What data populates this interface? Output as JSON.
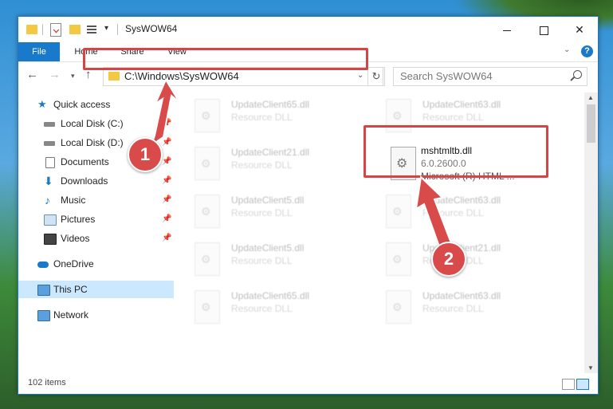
{
  "window": {
    "title": "SysWOW64"
  },
  "ribbon": {
    "tabs": [
      {
        "label": "File"
      },
      {
        "label": "Home"
      },
      {
        "label": "Share"
      },
      {
        "label": "View"
      }
    ],
    "help": "?"
  },
  "nav": {
    "address": "C:\\Windows\\SysWOW64",
    "search_placeholder": "Search SysWOW64"
  },
  "sidebar": {
    "items": [
      {
        "label": "Quick access"
      },
      {
        "label": "Local Disk (C:)"
      },
      {
        "label": "Local Disk (D:)"
      },
      {
        "label": "Documents"
      },
      {
        "label": "Downloads"
      },
      {
        "label": "Music"
      },
      {
        "label": "Pictures"
      },
      {
        "label": "Videos"
      },
      {
        "label": "OneDrive"
      },
      {
        "label": "This PC"
      },
      {
        "label": "Network"
      }
    ]
  },
  "files": {
    "blurred": [
      {
        "name": "UpdateClient65.dll",
        "type": "Resource DLL"
      },
      {
        "name": "UpdateClient63.dll",
        "type": "Resource DLL"
      },
      {
        "name": "UpdateClient21.dll",
        "type": "Resource DLL"
      },
      {
        "name": "UpdateClient5.dll",
        "type": "Resource DLL"
      },
      {
        "name": "UpdateClient63.dll",
        "type": "Resource DLL"
      },
      {
        "name": "UpdateClient5.dll",
        "type": "Resource DLL"
      },
      {
        "name": "UpdateClient21.dll",
        "type": "Resource DLL"
      },
      {
        "name": "UpdateClient65.dll",
        "type": "Resource DLL"
      },
      {
        "name": "UpdateClient63.dll",
        "type": "Resource DLL"
      }
    ],
    "highlighted": {
      "name": "mshtmltb.dll",
      "version": "6.0.2600.0",
      "description": "Microsoft (R) HTML ..."
    }
  },
  "status": {
    "items": "102 items"
  },
  "callouts": {
    "one": "1",
    "two": "2"
  },
  "colors": {
    "accent": "#1979ca",
    "highlight": "#d64545",
    "callout": "#d94b4b"
  }
}
